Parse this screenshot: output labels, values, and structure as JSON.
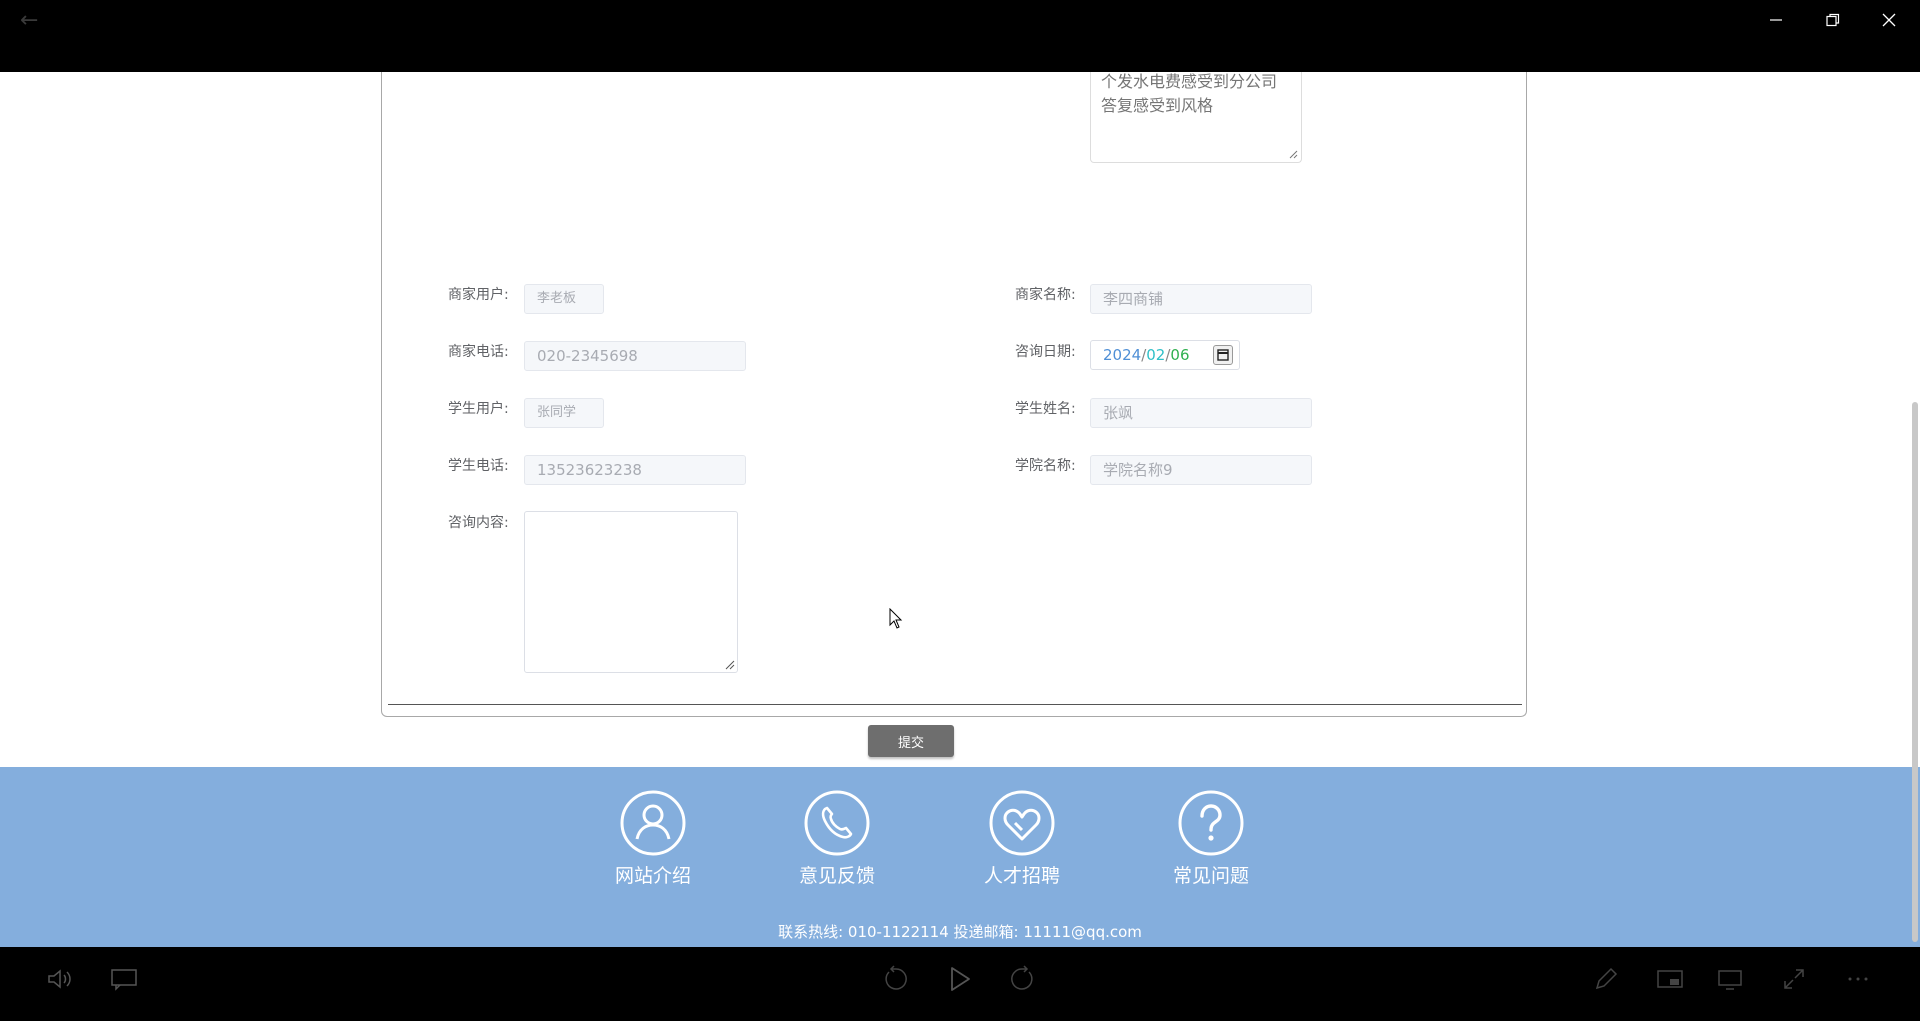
{
  "top_textarea": {
    "value": "网站里的各种类型精彩纷呈个发水电费感受到分公司答复感受到风格",
    "visible_lines": [
      "个发水电费感受到分公司",
      "答复感受到风格"
    ]
  },
  "form": {
    "merchant_user": {
      "label": "商家用户:",
      "value": "李老板"
    },
    "merchant_name": {
      "label": "商家名称:",
      "value": "李四商铺"
    },
    "merchant_phone": {
      "label": "商家电话:",
      "value": "020-2345698"
    },
    "consult_date": {
      "label": "咨询日期:",
      "year": "2024",
      "sep1": "/",
      "month": "02",
      "sep2": "/",
      "day": "06"
    },
    "student_user": {
      "label": "学生用户:",
      "value": "张同学"
    },
    "student_name": {
      "label": "学生姓名:",
      "value": "张飒"
    },
    "student_phone": {
      "label": "学生电话:",
      "value": "13523623238"
    },
    "college_name": {
      "label": "学院名称:",
      "value": "学院名称9"
    },
    "consult_content": {
      "label": "咨询内容:",
      "value": ""
    },
    "submit_label": "提交"
  },
  "footer": {
    "items": [
      {
        "label": "网站介绍",
        "icon": "user-icon"
      },
      {
        "label": "意见反馈",
        "icon": "phone-icon"
      },
      {
        "label": "人才招聘",
        "icon": "heart-icon"
      },
      {
        "label": "常见问题",
        "icon": "question-icon"
      }
    ],
    "contact": "联系热线: 010-1122114 投递邮箱: 11111@qq.com"
  },
  "colors": {
    "footer_bg": "#84aedd",
    "date_year": "#4f8fd6",
    "date_month": "#2fc0c8",
    "date_day": "#2fb04f",
    "submit_bg": "#6e6e6e"
  }
}
